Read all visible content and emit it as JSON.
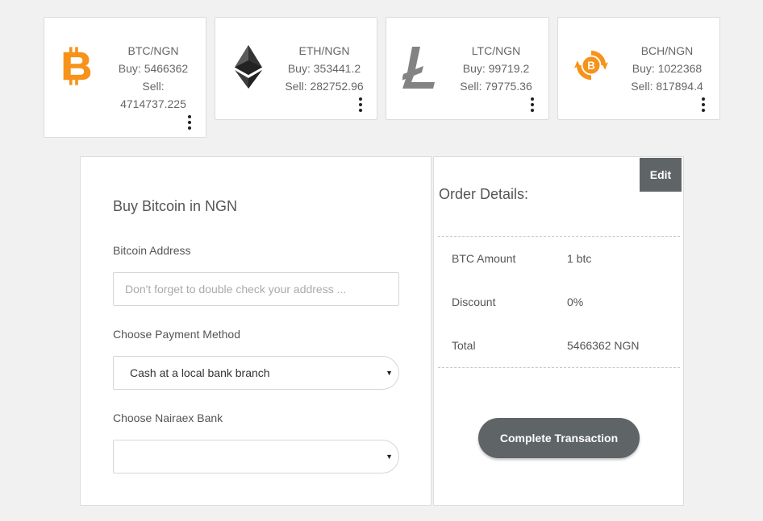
{
  "tickers": [
    {
      "pair": "BTC/NGN",
      "buy": "Buy: 5466362",
      "sell_label": "Sell:",
      "sell_value": "4714737.225",
      "icon": "bitcoin-icon",
      "color": "#f7931a"
    },
    {
      "pair": "ETH/NGN",
      "buy": "Buy: 353441.2",
      "sell": "Sell: 282752.96",
      "icon": "ethereum-icon",
      "color": "#343434"
    },
    {
      "pair": "LTC/NGN",
      "buy": "Buy: 99719.2",
      "sell": "Sell: 79775.36",
      "icon": "litecoin-icon",
      "color": "#838383"
    },
    {
      "pair": "BCH/NGN",
      "buy": "Buy: 1022368",
      "sell": "Sell: 817894.4",
      "icon": "bitcoin-cash-icon",
      "color": "#f7931a"
    }
  ],
  "form": {
    "title": "Buy Bitcoin in NGN",
    "address_label": "Bitcoin Address",
    "address_placeholder": "Don't forget to double check your address ...",
    "address_value": "",
    "payment_label": "Choose Payment Method",
    "payment_selected": "Cash at a local bank branch",
    "bank_label": "Choose Nairaex Bank",
    "bank_selected": "",
    "caret": "▼"
  },
  "order": {
    "title": "Order Details:",
    "edit_label": "Edit",
    "rows": [
      {
        "key": "BTC Amount",
        "value": "1 btc"
      },
      {
        "key": "Discount",
        "value": "0%"
      },
      {
        "key": "Total",
        "value": "5466362 NGN"
      }
    ],
    "complete_label": "Complete Transaction"
  },
  "colors": {
    "bitcoin_orange": "#f7931a",
    "button_gray": "#5f6467",
    "page_bg": "#f1f1f1"
  }
}
